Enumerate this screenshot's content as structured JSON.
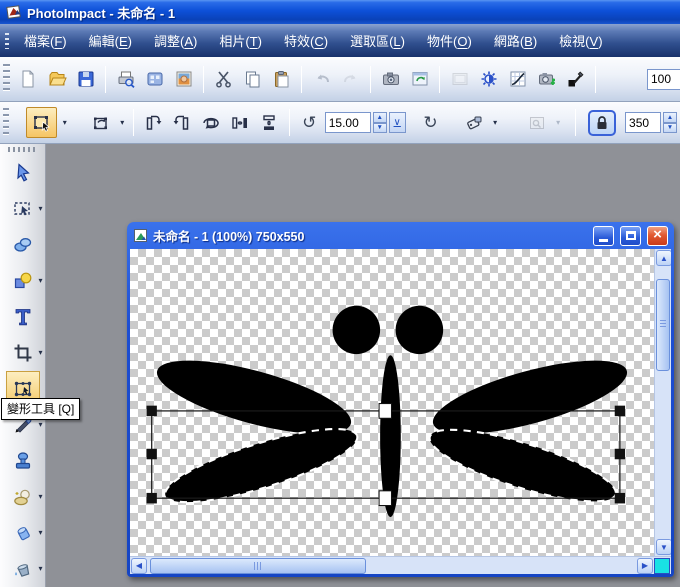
{
  "app": {
    "title": "PhotoImpact - 未命名 - 1",
    "icon": "photoimpact-app-icon"
  },
  "menu_bar": {
    "items": [
      {
        "label": "檔案(F)"
      },
      {
        "label": "編輯(E)"
      },
      {
        "label": "調整(A)"
      },
      {
        "label": "相片(T)"
      },
      {
        "label": "特效(C)"
      },
      {
        "label": "選取區(L)"
      },
      {
        "label": "物件(O)"
      },
      {
        "label": "網路(B)"
      },
      {
        "label": "檢視(V)"
      }
    ]
  },
  "standard_toolbar": {
    "zoom_value": "100",
    "buttons": [
      "new",
      "open",
      "save",
      "print",
      "screen-capture",
      "browse",
      "cut",
      "copy",
      "paste",
      "undo",
      "redo",
      "camera",
      "web-page",
      "enhance",
      "brightness-contrast",
      "tone-curve",
      "quick-fix",
      "color-picker"
    ],
    "disabled_buttons": [
      "undo",
      "redo",
      "enhance"
    ]
  },
  "transform_toolbar": {
    "selected_mode": "transform-tool",
    "rotate_angle_value": "15.00",
    "size_value": "350",
    "lock_pressed": true,
    "buttons": [
      "transform-tool",
      "transform-mode",
      "rotate-left",
      "rotate-right",
      "free-rotate",
      "flip-horizontal",
      "flip-vertical",
      "reset-rotate",
      "rotate-angle-input",
      "rotate-cw",
      "tag",
      "preview",
      "lock",
      "size-input"
    ]
  },
  "tool_palette": {
    "selected_tool": "transform-tool",
    "tooltip": "變形工具 [Q]",
    "tools": [
      "pick-tool",
      "selection-tool",
      "object-select-tool",
      "path-drawing-tool",
      "text-tool",
      "crop-tool",
      "transform-tool",
      "paintbrush-tool",
      "clone-tool",
      "retouch-tool",
      "eraser-tool",
      "fill-tool"
    ]
  },
  "document_window": {
    "title": "未命名 - 1 (100%) 750x550",
    "window_buttons": [
      "minimize",
      "maximize",
      "close"
    ],
    "canvas_object": "black dragonfly shape on transparent checkerboard with transform selection box"
  },
  "colors": {
    "titlebar_blue": "#0d50d8",
    "menubar_navy": "#31508f",
    "selected_tool_orange": "#f6c564",
    "close_button_red": "#e25a32",
    "quick_button_cyan": "#19e2e4",
    "checker_gray": "#cbcbcb",
    "artwork_black": "#000000"
  }
}
